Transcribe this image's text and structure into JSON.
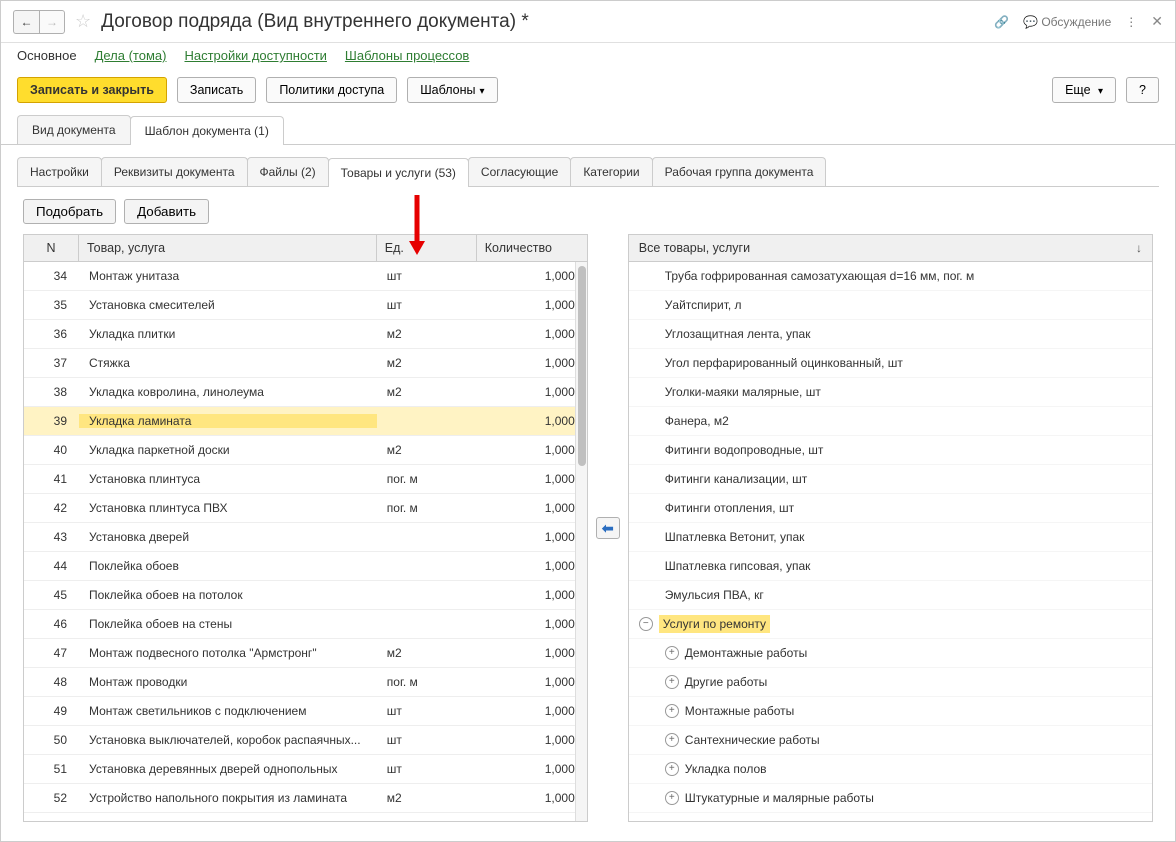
{
  "title": "Договор подряда (Вид внутреннего документа) *",
  "header_actions": {
    "discuss": "Обсуждение"
  },
  "topnav": {
    "main": "Основное",
    "cases": "Дела (тома)",
    "access_settings": "Настройки доступности",
    "templates": "Шаблоны процессов"
  },
  "toolbar": {
    "save_close": "Записать и закрыть",
    "save": "Записать",
    "access_policies": "Политики доступа",
    "templates": "Шаблоны",
    "more": "Еще",
    "help": "?"
  },
  "tabs_l1": {
    "doc_type": "Вид документа",
    "doc_template": "Шаблон документа (1)"
  },
  "tabs_l2": {
    "settings": "Настройки",
    "requisites": "Реквизиты документа",
    "files": "Файлы (2)",
    "goods": "Товары и услуги (53)",
    "approvers": "Согласующие",
    "categories": "Категории",
    "workgroup": "Рабочая группа документа"
  },
  "sub_toolbar": {
    "pick": "Подобрать",
    "add": "Добавить"
  },
  "grid_head": {
    "n": "N",
    "name": "Товар, услуга",
    "ed": "Ед.",
    "qty": "Количество"
  },
  "rows": [
    {
      "n": "34",
      "name": "Монтаж унитаза",
      "ed": "шт",
      "qty": "1,000"
    },
    {
      "n": "35",
      "name": "Установка смесителей",
      "ed": "шт",
      "qty": "1,000"
    },
    {
      "n": "36",
      "name": "Укладка плитки",
      "ed": "м2",
      "qty": "1,000"
    },
    {
      "n": "37",
      "name": "Стяжка",
      "ed": "м2",
      "qty": "1,000"
    },
    {
      "n": "38",
      "name": "Укладка ковролина, линолеума",
      "ed": "м2",
      "qty": "1,000"
    },
    {
      "n": "39",
      "name": "Укладка ламината",
      "ed": "",
      "qty": "1,000",
      "selected": true
    },
    {
      "n": "40",
      "name": "Укладка паркетной доски",
      "ed": "м2",
      "qty": "1,000"
    },
    {
      "n": "41",
      "name": "Установка плинтуса",
      "ed": "пог. м",
      "qty": "1,000"
    },
    {
      "n": "42",
      "name": "Установка плинтуса ПВХ",
      "ed": "пог. м",
      "qty": "1,000"
    },
    {
      "n": "43",
      "name": "Установка дверей",
      "ed": "",
      "qty": "1,000"
    },
    {
      "n": "44",
      "name": "Поклейка обоев",
      "ed": "",
      "qty": "1,000"
    },
    {
      "n": "45",
      "name": "Поклейка обоев на потолок",
      "ed": "",
      "qty": "1,000"
    },
    {
      "n": "46",
      "name": "Поклейка обоев на стены",
      "ed": "",
      "qty": "1,000"
    },
    {
      "n": "47",
      "name": "Монтаж подвесного потолка \"Армстронг\"",
      "ed": "м2",
      "qty": "1,000"
    },
    {
      "n": "48",
      "name": "Монтаж проводки",
      "ed": "пог. м",
      "qty": "1,000"
    },
    {
      "n": "49",
      "name": "Монтаж светильников с подключением",
      "ed": "шт",
      "qty": "1,000"
    },
    {
      "n": "50",
      "name": "Установка выключателей, коробок распаячных...",
      "ed": "шт",
      "qty": "1,000"
    },
    {
      "n": "51",
      "name": "Установка деревянных дверей однопольных",
      "ed": "шт",
      "qty": "1,000"
    },
    {
      "n": "52",
      "name": "Устройство напольного покрытия из ламината",
      "ed": "м2",
      "qty": "1,000"
    }
  ],
  "tree_head": "Все товары, услуги",
  "tree": [
    {
      "label": "Труба гофрированная самозатухающая d=16 мм, пог. м",
      "type": "item"
    },
    {
      "label": "Уайтспирит, л",
      "type": "item"
    },
    {
      "label": "Углозащитная лента, упак",
      "type": "item"
    },
    {
      "label": "Угол перфарированный оцинкованный, шт",
      "type": "item"
    },
    {
      "label": "Уголки-маяки малярные, шт",
      "type": "item"
    },
    {
      "label": "Фанера, м2",
      "type": "item"
    },
    {
      "label": "Фитинги водопроводные, шт",
      "type": "item"
    },
    {
      "label": "Фитинги канализации, шт",
      "type": "item"
    },
    {
      "label": "Фитинги отопления, шт",
      "type": "item"
    },
    {
      "label": "Шпатлевка Ветонит, упак",
      "type": "item"
    },
    {
      "label": "Шпатлевка гипсовая, упак",
      "type": "item"
    },
    {
      "label": "Эмульсия ПВА, кг",
      "type": "item"
    },
    {
      "label": "Услуги по ремонту",
      "type": "group",
      "expanded": true,
      "highlighted": true
    },
    {
      "label": "Демонтажные работы",
      "type": "child"
    },
    {
      "label": "Другие работы",
      "type": "child"
    },
    {
      "label": "Монтажные работы",
      "type": "child"
    },
    {
      "label": "Сантехнические работы",
      "type": "child"
    },
    {
      "label": "Укладка полов",
      "type": "child"
    },
    {
      "label": "Штукатурные и малярные работы",
      "type": "child"
    }
  ]
}
